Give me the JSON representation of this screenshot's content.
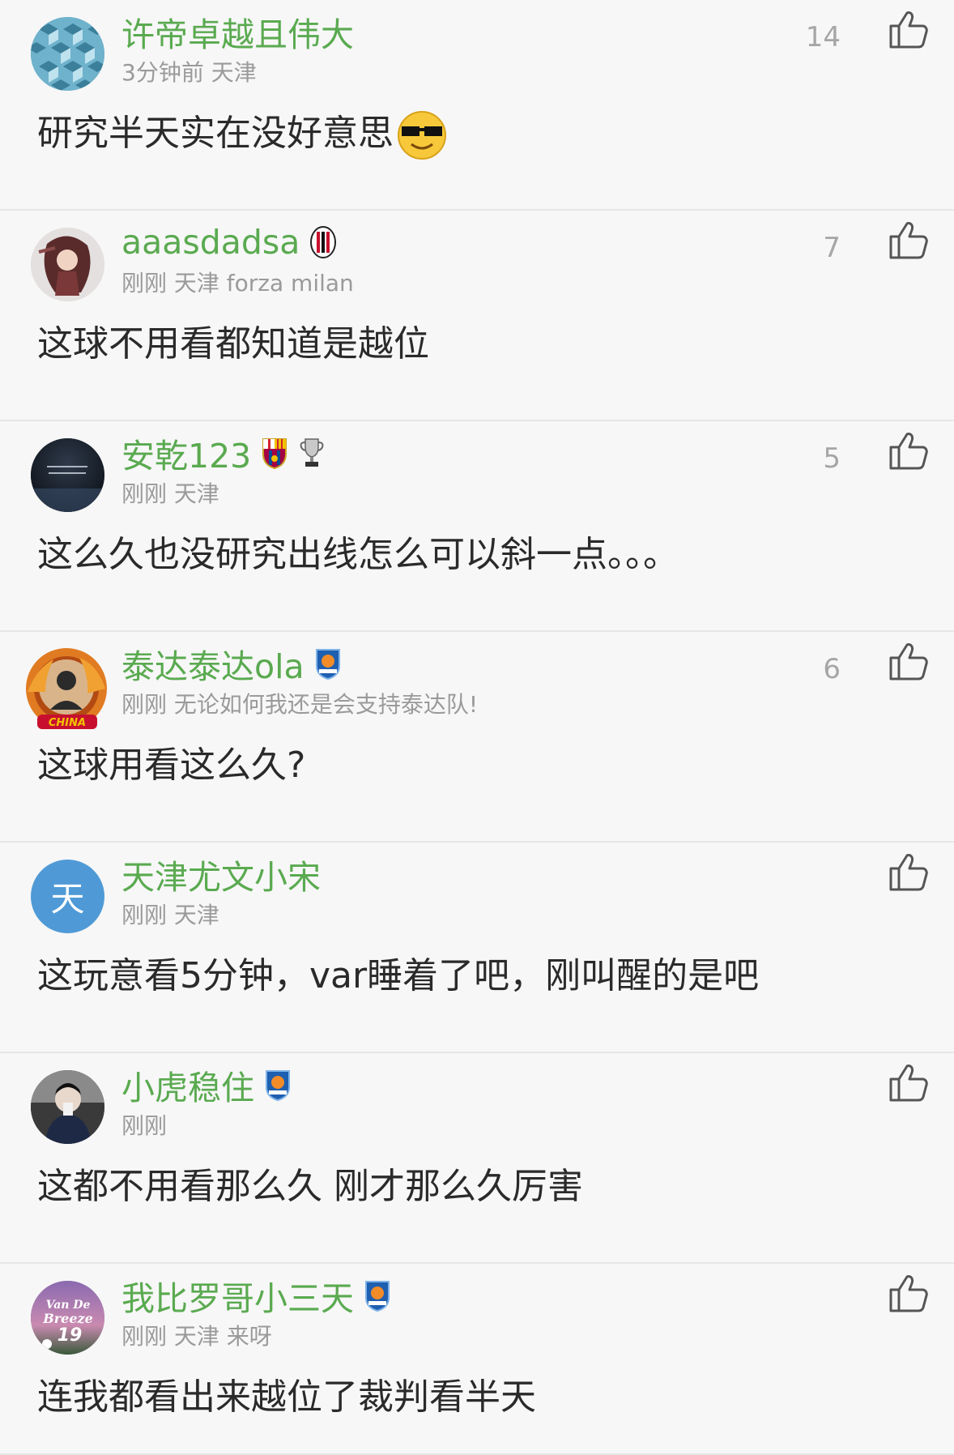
{
  "comments": [
    {
      "username": "许帝卓越且伟大",
      "meta": "3分钟前 天津",
      "likes": "14",
      "text": "研究半天实在没好意思",
      "avatar_type": "pattern",
      "emoji": "sunglasses-smiley"
    },
    {
      "username": "aaasdadsa",
      "meta": "刚刚 天津 forza milan",
      "likes": "7",
      "text": "这球不用看都知道是越位",
      "avatar_type": "anime",
      "badges": [
        "ac-milan-badge"
      ]
    },
    {
      "username": "安乾123",
      "meta": "刚刚 天津",
      "likes": "5",
      "text": "这么久也没研究出线怎么可以斜一点。。。",
      "avatar_type": "dark-text",
      "badges": [
        "barcelona-badge",
        "trophy-badge"
      ]
    },
    {
      "username": "泰达泰达ola",
      "meta": "刚刚 无论如何我还是会支持泰达队!",
      "likes": "6",
      "text": "这球用看这么久?",
      "avatar_type": "dragon",
      "badges": [
        "teda-badge"
      ]
    },
    {
      "username": "天津尤文小宋",
      "meta": "刚刚 天津",
      "likes": "",
      "text": "这玩意看5分钟，var睡着了吧，刚叫醒的是吧",
      "avatar_type": "letter",
      "avatar_letter": "天"
    },
    {
      "username": "小虎稳住",
      "meta": "刚刚",
      "likes": "",
      "text": "这都不用看那么久 刚才那么久厉害",
      "avatar_type": "photo",
      "badges": [
        "teda-badge"
      ]
    },
    {
      "username": "我比罗哥小三天",
      "meta": "刚刚 天津 来呀",
      "likes": "",
      "text": "连我都看出来越位了裁判看半天",
      "avatar_type": "breeze",
      "badges": [
        "teda-badge"
      ]
    }
  ],
  "colors": {
    "username": "#5aaa50",
    "meta": "#9a9a9a",
    "text": "#2a2a2a",
    "avatar_letter_bg": "#4f9ad6"
  }
}
